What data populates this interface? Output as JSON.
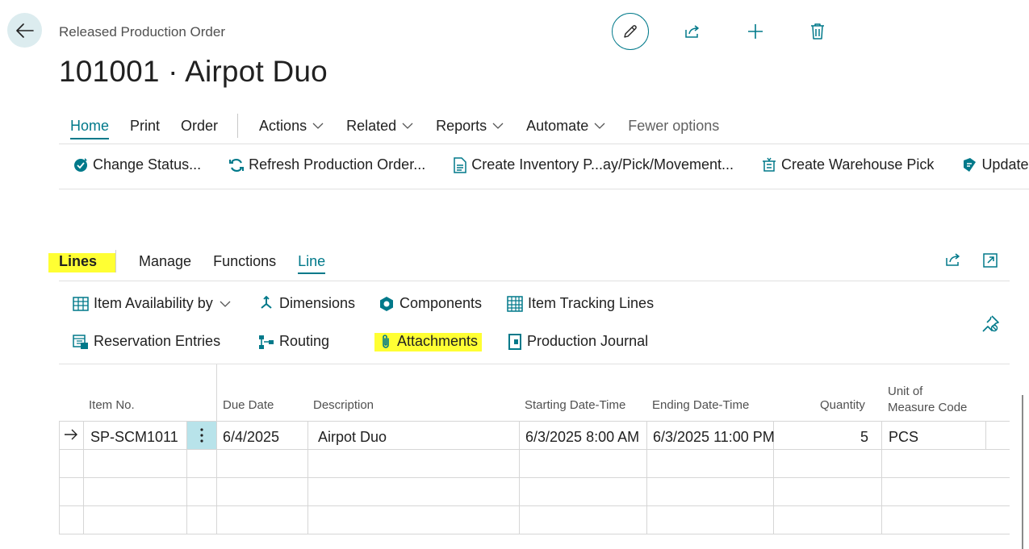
{
  "header": {
    "caption": "Released Production Order",
    "title": "101001 · Airpot Duo"
  },
  "menu": {
    "tabs": [
      "Home",
      "Print",
      "Order"
    ],
    "dropdowns": [
      "Actions",
      "Related",
      "Reports",
      "Automate"
    ],
    "fewer": "Fewer options"
  },
  "actions": [
    "Change Status...",
    "Refresh Production Order...",
    "Create Inventory P...ay/Pick/Movement...",
    "Create Warehouse Pick",
    "Update Unit C"
  ],
  "lines": {
    "tabs": [
      "Lines",
      "Manage",
      "Functions",
      "Line"
    ],
    "actions": {
      "item_availability": "Item Availability by",
      "dimensions": "Dimensions",
      "components": "Components",
      "item_tracking": "Item Tracking Lines",
      "reservation": "Reservation Entries",
      "routing": "Routing",
      "attachments": "Attachments",
      "production_journal": "Production Journal"
    }
  },
  "table": {
    "headers": {
      "item_no": "Item No.",
      "due_date": "Due Date",
      "description": "Description",
      "start": "Starting Date-Time",
      "end": "Ending Date-Time",
      "quantity": "Quantity",
      "uom_line1": "Unit of",
      "uom_line2": "Measure Code"
    },
    "row": {
      "item_no": "SP-SCM1011",
      "due_date": "6/4/2025",
      "description": "Airpot Duo",
      "start": "6/3/2025 8:00 AM",
      "end": "6/3/2025 11:00 PM",
      "quantity": "5",
      "uom": "PCS"
    }
  },
  "colors": {
    "accent": "#00798a",
    "highlight": "#ffff33"
  }
}
